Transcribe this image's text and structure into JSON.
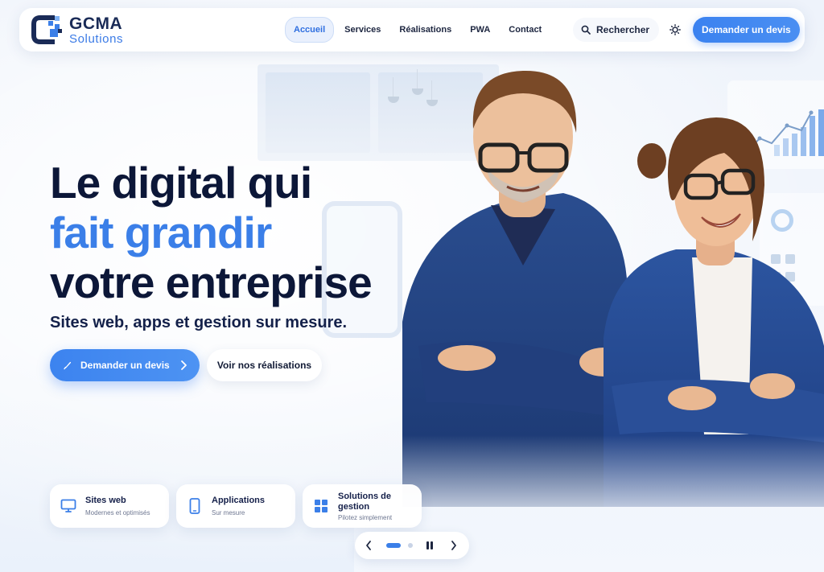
{
  "brand": {
    "name": "GCMA",
    "tagline": "Solutions",
    "accent_color": "#3b7fe8",
    "dark_color": "#0c1738"
  },
  "nav": {
    "items": [
      {
        "label": "Accueil",
        "active": true
      },
      {
        "label": "Services"
      },
      {
        "label": "Réalisations"
      },
      {
        "label": "PWA"
      },
      {
        "label": "Contact"
      }
    ],
    "search_label": "Rechercher",
    "search_icon": "search-icon",
    "theme_icon": "sun-icon",
    "cta_label": "Demander un devis"
  },
  "hero": {
    "title_line1": "Le digital qui",
    "title_line2": "fait grandir",
    "title_line3": "votre entreprise",
    "subtitle": "Sites web, apps et gestion sur mesure.",
    "primary_cta": "Demander un devis",
    "primary_cta_icon": "rocket-icon",
    "secondary_cta": "Voir nos réalisations"
  },
  "features": [
    {
      "title": "Sites web",
      "subtitle": "Modernes et optimisés",
      "icon": "monitor-icon"
    },
    {
      "title": "Applications",
      "subtitle": "Sur mesure",
      "icon": "smartphone-icon"
    },
    {
      "title": "Solutions de gestion",
      "subtitle": "Pilotez simplement",
      "icon": "grid-icon"
    }
  ],
  "slider": {
    "slide_count": 2,
    "current_slide": 1,
    "paused": false
  }
}
